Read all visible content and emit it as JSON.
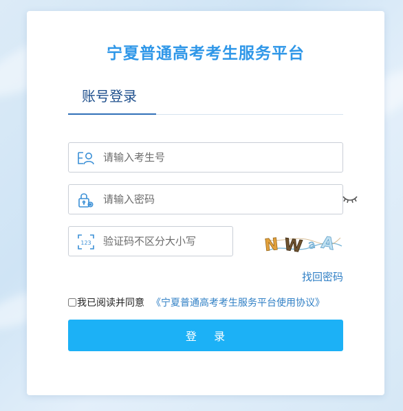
{
  "page": {
    "title": "宁夏普通高考考生服务平台"
  },
  "tabs": [
    {
      "label": "账号登录",
      "active": true
    }
  ],
  "form": {
    "username": {
      "value": "",
      "placeholder": "请输入考生号",
      "icon": "user-id-icon"
    },
    "password": {
      "value": "",
      "placeholder": "请输入密码",
      "icon": "lock-icon",
      "toggle_icon": "eye-closed-icon"
    },
    "captcha": {
      "value": "",
      "placeholder": "验证码不区分大小写",
      "icon": "captcha-code-icon",
      "image_text": "NWaA"
    },
    "forgot_label": "找回密码",
    "agree_label": "我已阅读并同意",
    "agree_checked": false,
    "agreement_link": "《宁夏普通高考考生服务平台使用协议》",
    "submit_label": "登    录"
  },
  "colors": {
    "title": "#2f97e8",
    "tab_active": "#1e4f8c",
    "link": "#2f7fc5",
    "button": "#1cb1f6",
    "icon": "#3a8fd6"
  }
}
